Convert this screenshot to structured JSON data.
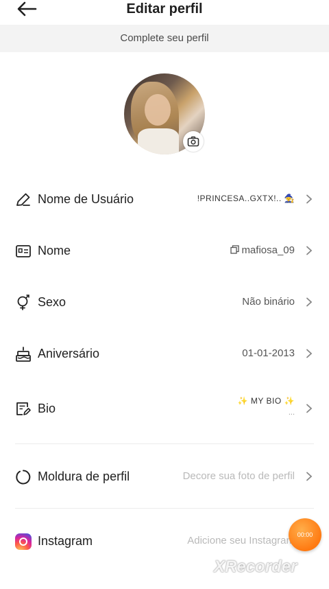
{
  "header": {
    "title": "Editar perfil",
    "back_icon": "arrow-left-icon"
  },
  "banner": {
    "text": "Complete seu perfil"
  },
  "avatar": {
    "camera_icon": "camera-icon"
  },
  "rows": [
    {
      "label": "Nome de Usuário",
      "value": "!PRINCESA..GXTX!.. 🧙",
      "icon": "pencil-icon"
    },
    {
      "label": "Nome",
      "value": "mafiosa_09",
      "icon": "id-card-icon"
    },
    {
      "label": "Sexo",
      "value": "Não binário",
      "icon": "gender-icon"
    },
    {
      "label": "Aniversário",
      "value": "01-01-2013",
      "icon": "cake-icon"
    },
    {
      "label": "Bio",
      "value": "✨ MY BIO ✨",
      "value_sub": "...",
      "icon": "edit-note-icon"
    },
    {
      "label": "Moldura de perfil",
      "placeholder": "Decore sua foto de perfil",
      "icon": "frame-circle-icon"
    },
    {
      "label": "Instagram",
      "placeholder": "Adicione seu Instagram",
      "icon": "instagram-icon"
    }
  ],
  "recorder": {
    "timer": "00:00"
  },
  "watermark": "XRecorder",
  "colors": {
    "accent_recorder": "#ff8a1f",
    "banner_bg": "#f3f3f3",
    "placeholder": "#b9b9b9"
  }
}
